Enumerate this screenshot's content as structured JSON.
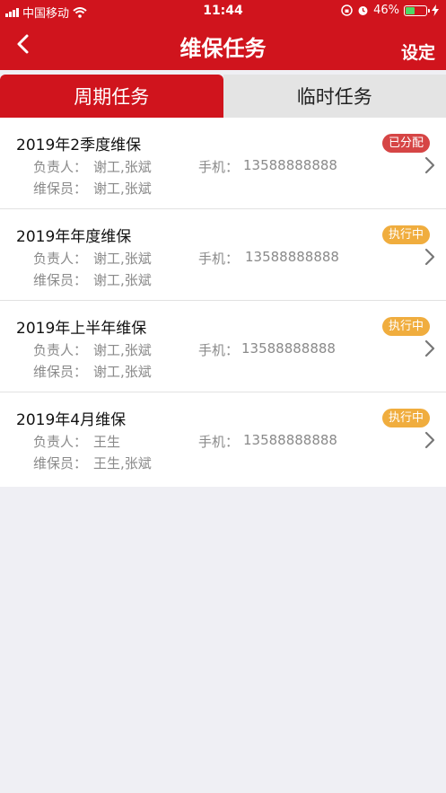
{
  "status_bar": {
    "carrier": "中国移动",
    "time": "11:44",
    "battery_percent": "46%",
    "battery_level": 0.46
  },
  "nav": {
    "title": "维保任务",
    "settings_label": "设定"
  },
  "tabs": [
    {
      "label": "周期任务",
      "active": true
    },
    {
      "label": "临时任务",
      "active": false
    }
  ],
  "tasks": [
    {
      "title": "2019年2季度维保",
      "status": "已分配",
      "status_color": "#d64545",
      "manager_label": "负责人：",
      "manager": "谢工,张斌",
      "phone_label": "手机：",
      "phone": "13588888888",
      "workers_label": "维保员：",
      "workers": "谢工,张斌"
    },
    {
      "title": "2019年年度维保",
      "status": "执行中",
      "status_color": "#f0ad3e",
      "manager_label": "负责人：",
      "manager": "谢工,张斌",
      "phone_label": "手机：",
      "phone": "13588888888",
      "workers_label": "维保员：",
      "workers": "谢工,张斌"
    },
    {
      "title": "2019年上半年维保",
      "status": "执行中",
      "status_color": "#f0ad3e",
      "manager_label": "负责人：",
      "manager": "谢工,张斌",
      "phone_label": "手机：",
      "phone": "13588888888",
      "workers_label": "维保员：",
      "workers": "谢工,张斌"
    },
    {
      "title": "2019年4月维保",
      "status": "执行中",
      "status_color": "#f0ad3e",
      "manager_label": "负责人：",
      "manager": "王生",
      "phone_label": "手机：",
      "phone": "13588888888",
      "workers_label": "维保员：",
      "workers": "王生,张斌"
    }
  ],
  "colors": {
    "brand_red": "#d0141d",
    "background": "#efeff4"
  }
}
